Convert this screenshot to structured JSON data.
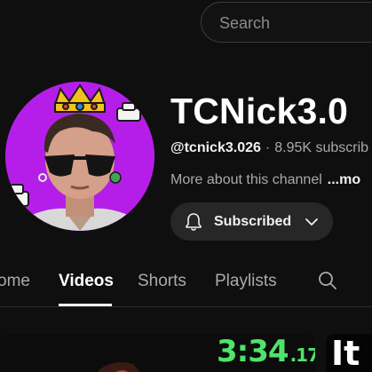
{
  "search": {
    "placeholder": "Search"
  },
  "channel": {
    "name": "TCNick3.0",
    "handle": "@tcnick3.026",
    "separator": "·",
    "subscribers": "8.95K subscrib",
    "about": "More about this channel",
    "about_more": "...mo",
    "avatar_bg": "#b51ee8"
  },
  "subscribe_button": {
    "label": "Subscribed",
    "icon": "bell-icon",
    "dropdown_icon": "chevron-down-icon"
  },
  "tabs": [
    {
      "label": "ome",
      "active": false
    },
    {
      "label": "Videos",
      "active": true
    },
    {
      "label": "Shorts",
      "active": false
    },
    {
      "label": "Playlists",
      "active": false
    }
  ],
  "tab_search_icon": "search-icon",
  "videos": [
    {
      "duration_main": "3:34",
      "duration_frac": ".17",
      "badge_color": "#4fe36b"
    },
    {
      "overlay_text": "It"
    }
  ]
}
